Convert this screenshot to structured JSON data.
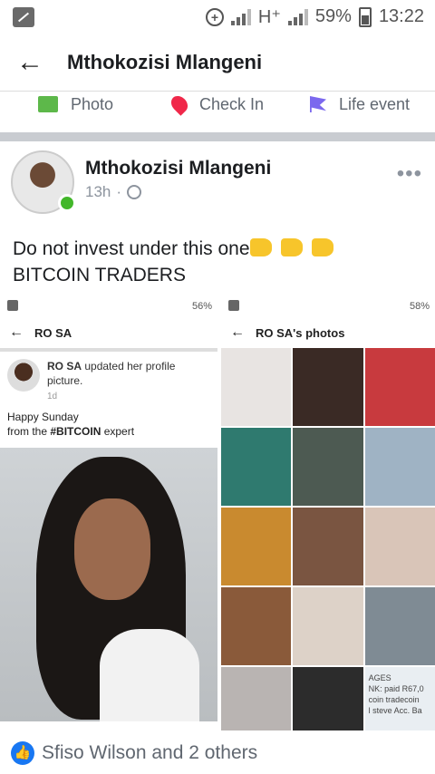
{
  "status_bar": {
    "network": "H⁺",
    "battery": "59%",
    "time": "13:22"
  },
  "header": {
    "title": "Mthokozisi Mlangeni"
  },
  "composer": {
    "photo_label": "Photo",
    "checkin_label": "Check In",
    "life_event_label": "Life event"
  },
  "post": {
    "author": "Mthokozisi Mlangeni",
    "time": "13h",
    "text_line1": "Do not invest under this one",
    "text_line2": "BITCOIN TRADERS",
    "reactions_text": "Sfiso Wilson and 2 others"
  },
  "screenshot_left": {
    "status_battery": "56%",
    "header_title": "RO SA",
    "poster_name": "RO SA",
    "poster_action": "updated her profile picture.",
    "time": "1d",
    "text_line1": "Happy Sunday",
    "text_line2_prefix": "from the ",
    "hashtag": "#BITCOIN",
    "text_line2_suffix": " expert"
  },
  "screenshot_right": {
    "status_battery": "58%",
    "header_title": "RO SA's photos",
    "note_text": "AGES\nNK: paid R67,0\ncoin tradecoin\nl steve Acc. Ba"
  },
  "colors": {
    "facebook_blue": "#1877f2",
    "online_green": "#42b72a",
    "divider_gray": "#c9ccd1"
  }
}
